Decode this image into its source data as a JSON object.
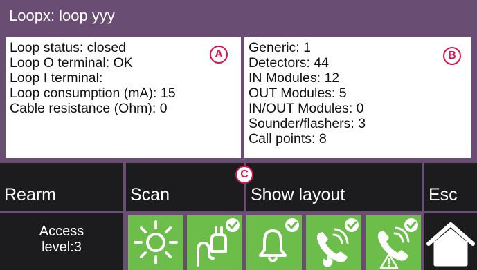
{
  "window": {
    "title": "Loopx: loop yyy"
  },
  "panel_a": {
    "marker": "A",
    "lines": [
      "Loop status: closed",
      "Loop O terminal: OK",
      "Loop I terminal:",
      "Loop consumption (mA): 15",
      "Cable resistance (Ohm): 0"
    ]
  },
  "panel_b": {
    "marker": "B",
    "lines": [
      "Generic: 1",
      "Detectors: 44",
      "IN Modules: 12",
      "OUT Modules: 5",
      "IN/OUT Modules: 0",
      "Sounder/flashers: 3",
      "Call points: 8"
    ]
  },
  "buttons": {
    "marker": "C",
    "rearm": "Rearm",
    "scan": "Scan",
    "show_layout": "Show layout",
    "esc": "Esc"
  },
  "status_bar": {
    "access_line1": "Access",
    "access_line2": "level:3",
    "icons": [
      "sun-icon",
      "power-plug-check-icon",
      "bell-check-icon",
      "phone-fire-check-icon",
      "phone-warning-check-icon",
      "home-icon"
    ]
  },
  "colors": {
    "frame": "#6a4d72",
    "button": "#1c1c1e",
    "tile_green": "#6cbd4a",
    "marker_red": "#d9144f"
  }
}
